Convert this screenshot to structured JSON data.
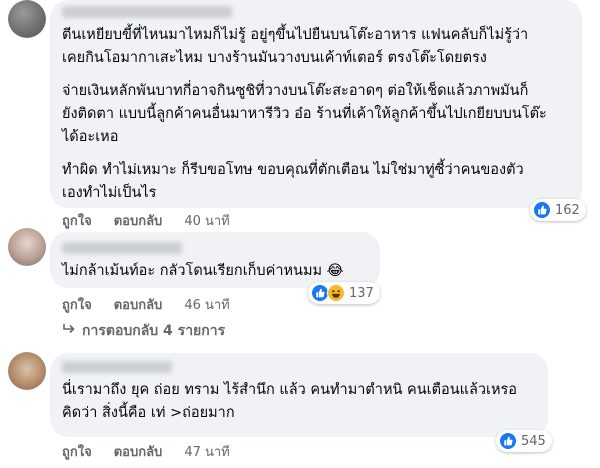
{
  "comments": [
    {
      "paragraphs": [
        "ตีนเหยียบขี้ที่ไหนมาไหมก็ไม่รู้ อยู่ๆขึ้นไปยืนบนโต๊ะอาหาร แฟนคลับก็ไม่รู้ว่า\nเคยกินโอมากาเสะไหม บางร้านมันวางบนเค้าท์เตอร์ ตรงโต๊ะโดยตรง",
        "จ่ายเงินหลักพันบาทกี่อาจกินซูชิที่วางบนโต๊ะสะอาดๆ ต่อให้เช็ดแล้วภาพมันก็\nยังติดตา แบบนี้ลูกค้าคนอื่นมาหารีวิว อ๋อ ร้านที่เค้าให้ลูกค้าขึ้นไปเกยียบบนโต๊ะ\nได้อะเหอ",
        "ทำผิด ทำไม่เหมาะ ก็รีบขอโทษ ขอบคุณที่ตักเตือน ไม่ใช่มาทู่ซี้ว่าคนของตัว\nเองทำไม่เป็นไร"
      ],
      "like_label": "ถูกใจ",
      "reply_label": "ตอบกลับ",
      "time": "40 นาที",
      "reaction_count": "162"
    },
    {
      "paragraphs": [
        "ไม่กล้าเม้นท์อะ กลัวโดนเรียกเก็บค่าหนมม 😂"
      ],
      "like_label": "ถูกใจ",
      "reply_label": "ตอบกลับ",
      "time": "46 นาที",
      "reaction_count": "137"
    },
    {
      "paragraphs": [
        "นี่เรามาถึง ยุค ถ่อย ทราม ไร้สำนึก แล้ว คนทำมาตำหนิ คนเตือนแล้วเหรอ\nคิดว่า สิ่งนี้คือ เท่ >ถ่อยมาก"
      ],
      "like_label": "ถูกใจ",
      "reply_label": "ตอบกลับ",
      "time": "47 นาที",
      "reaction_count": "545"
    }
  ],
  "view_replies": "การตอบกลับ 4 รายการ",
  "colors": {
    "bubble": "#f0f2f5",
    "like_blue": "#1877f2",
    "meta": "#65676b"
  }
}
